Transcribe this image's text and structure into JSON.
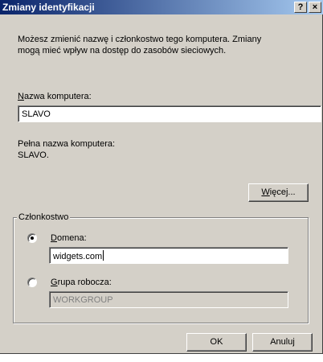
{
  "dialog": {
    "title": "Zmiany identyfikacji",
    "help_button": "?",
    "close_button": "×",
    "description_line1": "Możesz zmienić nazwę i członkostwo tego komputera. Zmiany",
    "description_line2": "mogą mieć wpływ na dostęp do zasobów sieciowych."
  },
  "computer_name": {
    "label_accel": "N",
    "label_rest": "azwa komputera:",
    "value": "SLAVO"
  },
  "full_name": {
    "label": "Pełna nazwa komputera:",
    "value": "SLAVO."
  },
  "more_button": {
    "accel": "W",
    "rest": "ięcej..."
  },
  "membership": {
    "group_label": "Członkostwo",
    "domain": {
      "label_accel": "D",
      "label_rest": "omena:",
      "selected": true,
      "value": "widgets.com"
    },
    "workgroup": {
      "label_accel": "G",
      "label_rest": "rupa robocza:",
      "selected": false,
      "value": "WORKGROUP"
    }
  },
  "footer": {
    "ok_label": "OK",
    "cancel_label": "Anuluj"
  }
}
